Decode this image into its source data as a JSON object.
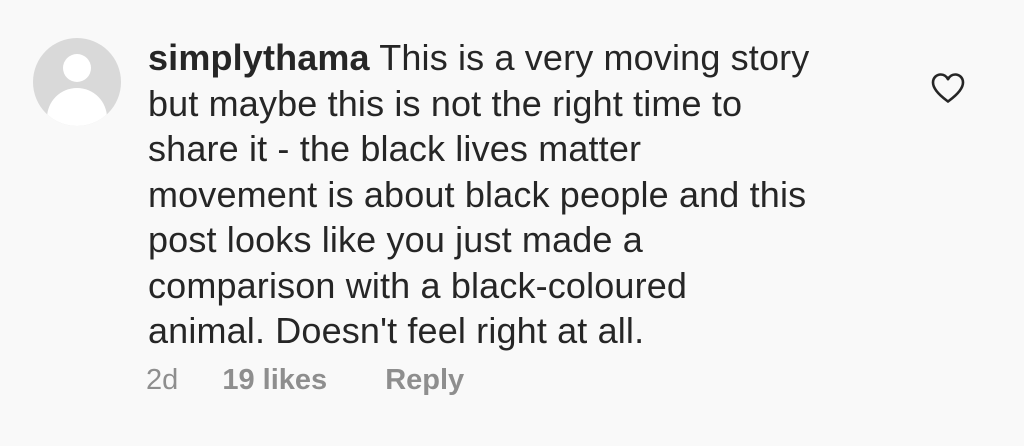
{
  "comment": {
    "username": "simplythama",
    "text_lines": [
      "This is a very moving story",
      "but maybe this is not the right time to",
      "share it - the black lives matter",
      "movement is about black people and this",
      "post looks like you just made a",
      "comparison with a black-coloured",
      "animal. Doesn't feel right at all."
    ],
    "time": "2d",
    "likes": "19 likes",
    "reply_label": "Reply",
    "like_icon": "heart-outline-icon",
    "avatar_icon": "default-avatar-icon"
  },
  "colors": {
    "background": "#f9f9f9",
    "text": "#262626",
    "meta": "#8e8e8e",
    "avatar_bg": "#d9d9d9"
  }
}
